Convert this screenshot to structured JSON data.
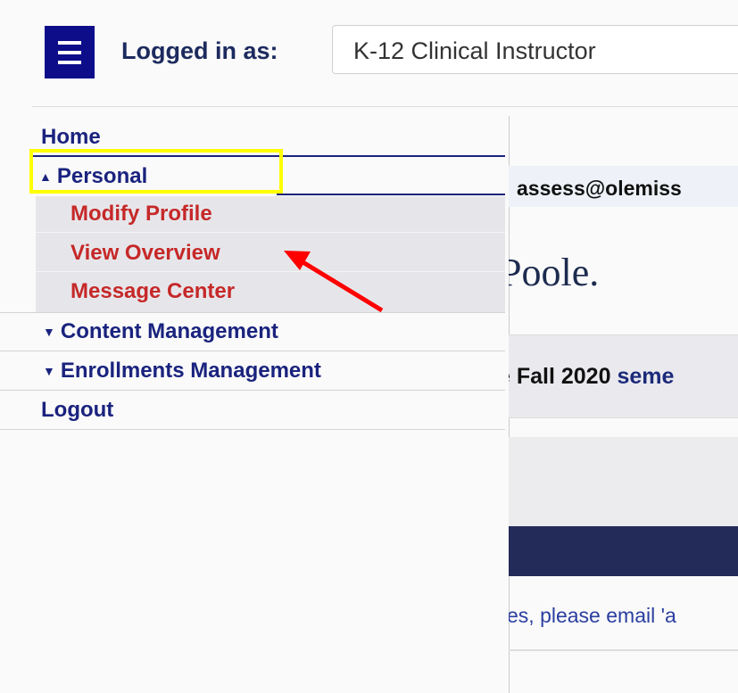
{
  "header": {
    "logged_in_label": "Logged in as:",
    "role": "K-12 Clinical Instructor"
  },
  "sidebar": {
    "home": "Home",
    "personal": {
      "label": "Personal",
      "expanded": true,
      "items": [
        "Modify Profile",
        "View Overview",
        "Message Center"
      ]
    },
    "content_management": "Content Management",
    "enrollments_management": "Enrollments Management",
    "logout": "Logout"
  },
  "content": {
    "email": "assess@olemiss",
    "greeting": "Poole.",
    "semester_prefix": "e ",
    "semester_bold": "Fall 2020",
    "semester_suffix": " seme",
    "email_note": "es, please email 'a"
  },
  "annotations": {
    "highlight_color": "#ffff00",
    "arrow_color": "#ff0000"
  }
}
